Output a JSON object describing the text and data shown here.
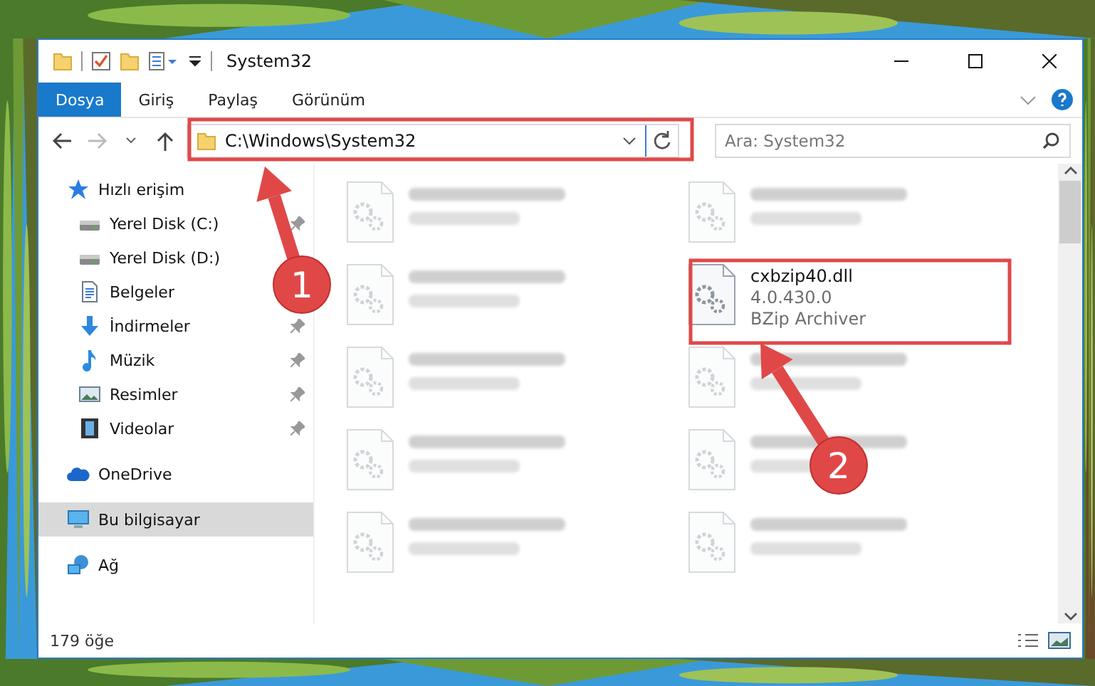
{
  "window": {
    "title": "System32"
  },
  "ribbon_tabs": [
    {
      "label": "Dosya",
      "selected": true
    },
    {
      "label": "Giriş",
      "selected": false
    },
    {
      "label": "Paylaş",
      "selected": false
    },
    {
      "label": "Görünüm",
      "selected": false
    }
  ],
  "address_bar": {
    "path": "C:\\Windows\\System32"
  },
  "search": {
    "placeholder": "Ara: System32"
  },
  "sidebar": {
    "items": [
      {
        "label": "Hızlı erişim",
        "kind": "quick-access",
        "selected": false,
        "children": [
          {
            "label": "Yerel Disk (C:)",
            "kind": "drive",
            "pinned": true,
            "selected": false
          },
          {
            "label": "Yerel Disk (D:)",
            "kind": "drive",
            "pinned": false,
            "selected": false
          },
          {
            "label": "Belgeler",
            "kind": "documents",
            "pinned": false,
            "selected": false
          },
          {
            "label": "İndirmeler",
            "kind": "downloads",
            "pinned": true,
            "selected": false
          },
          {
            "label": "Müzik",
            "kind": "music",
            "pinned": true,
            "selected": false
          },
          {
            "label": "Resimler",
            "kind": "pictures",
            "pinned": true,
            "selected": false
          },
          {
            "label": "Videolar",
            "kind": "videos",
            "pinned": true,
            "selected": false
          }
        ]
      },
      {
        "label": "OneDrive",
        "kind": "cloud",
        "selected": false
      },
      {
        "label": "Bu bilgisayar",
        "kind": "computer",
        "selected": true
      },
      {
        "label": "Ağ",
        "kind": "network",
        "selected": false
      }
    ]
  },
  "files": [
    {
      "blurred": true
    },
    {
      "blurred": true
    },
    {
      "blurred": true
    },
    {
      "name": "cxbzip40.dll",
      "line_1": "4.0.430.0",
      "line_2": "BZip Archiver",
      "blurred": false
    },
    {
      "blurred": true
    },
    {
      "blurred": true
    },
    {
      "blurred": true
    },
    {
      "blurred": true
    },
    {
      "blurred": true
    },
    {
      "blurred": true
    }
  ],
  "status_bar": {
    "count": "179 öğe"
  },
  "annotations": [
    {
      "number": "1"
    },
    {
      "number": "2"
    }
  ]
}
